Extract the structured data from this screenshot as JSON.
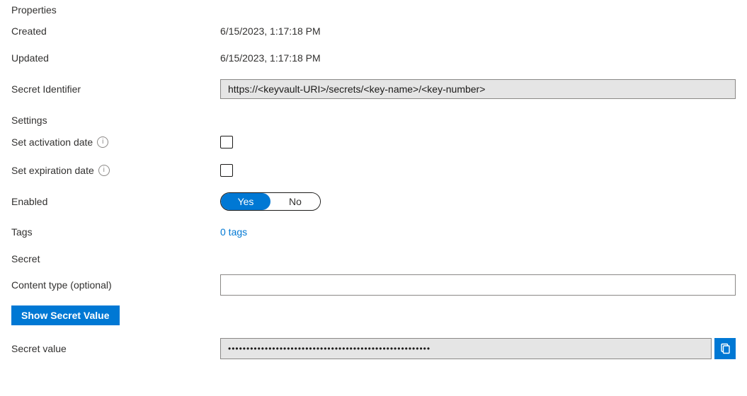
{
  "sections": {
    "properties": "Properties",
    "settings": "Settings",
    "secret": "Secret"
  },
  "properties": {
    "created_label": "Created",
    "created_value": "6/15/2023, 1:17:18 PM",
    "updated_label": "Updated",
    "updated_value": "6/15/2023, 1:17:18 PM",
    "identifier_label": "Secret Identifier",
    "identifier_value": "https://<keyvault-URI>/secrets/<key-name>/<key-number>"
  },
  "settings": {
    "activation_label": "Set activation date",
    "activation_checked": false,
    "expiration_label": "Set expiration date",
    "expiration_checked": false,
    "enabled_label": "Enabled",
    "enabled_yes": "Yes",
    "enabled_no": "No",
    "enabled_value": "Yes",
    "tags_label": "Tags",
    "tags_link": "0 tags"
  },
  "secret": {
    "content_type_label": "Content type (optional)",
    "content_type_value": "",
    "show_secret_btn": "Show Secret Value",
    "secret_value_label": "Secret value",
    "secret_value_masked": "•••••••••••••••••••••••••••••••••••••••••••••••••••••••"
  }
}
